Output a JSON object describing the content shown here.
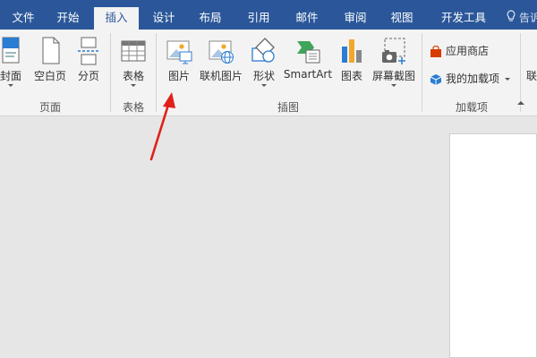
{
  "tabs": [
    "文件",
    "开始",
    "插入",
    "设计",
    "布局",
    "引用",
    "邮件",
    "审阅",
    "视图",
    "开发工具"
  ],
  "active_tab": "插入",
  "tell_me": "告诉",
  "ribbon": {
    "pages": {
      "cover": "封面",
      "blank": "空白页",
      "break": "分页",
      "group": "页面"
    },
    "tables": {
      "table": "表格",
      "group": "表格"
    },
    "illustrations": {
      "picture": "图片",
      "online_picture": "联机图片",
      "shapes": "形状",
      "smartart": "SmartArt",
      "chart": "图表",
      "screenshot": "屏幕截图",
      "group": "插图"
    },
    "addins": {
      "store": "应用商店",
      "my_addins": "我的加载项",
      "group": "加载项"
    },
    "partial_next": "联"
  },
  "colors": {
    "tab_bar": "#2b579a",
    "ribbon": "#f3f3f3",
    "canvas": "#e6e6e6",
    "arrow": "#e0201b"
  }
}
